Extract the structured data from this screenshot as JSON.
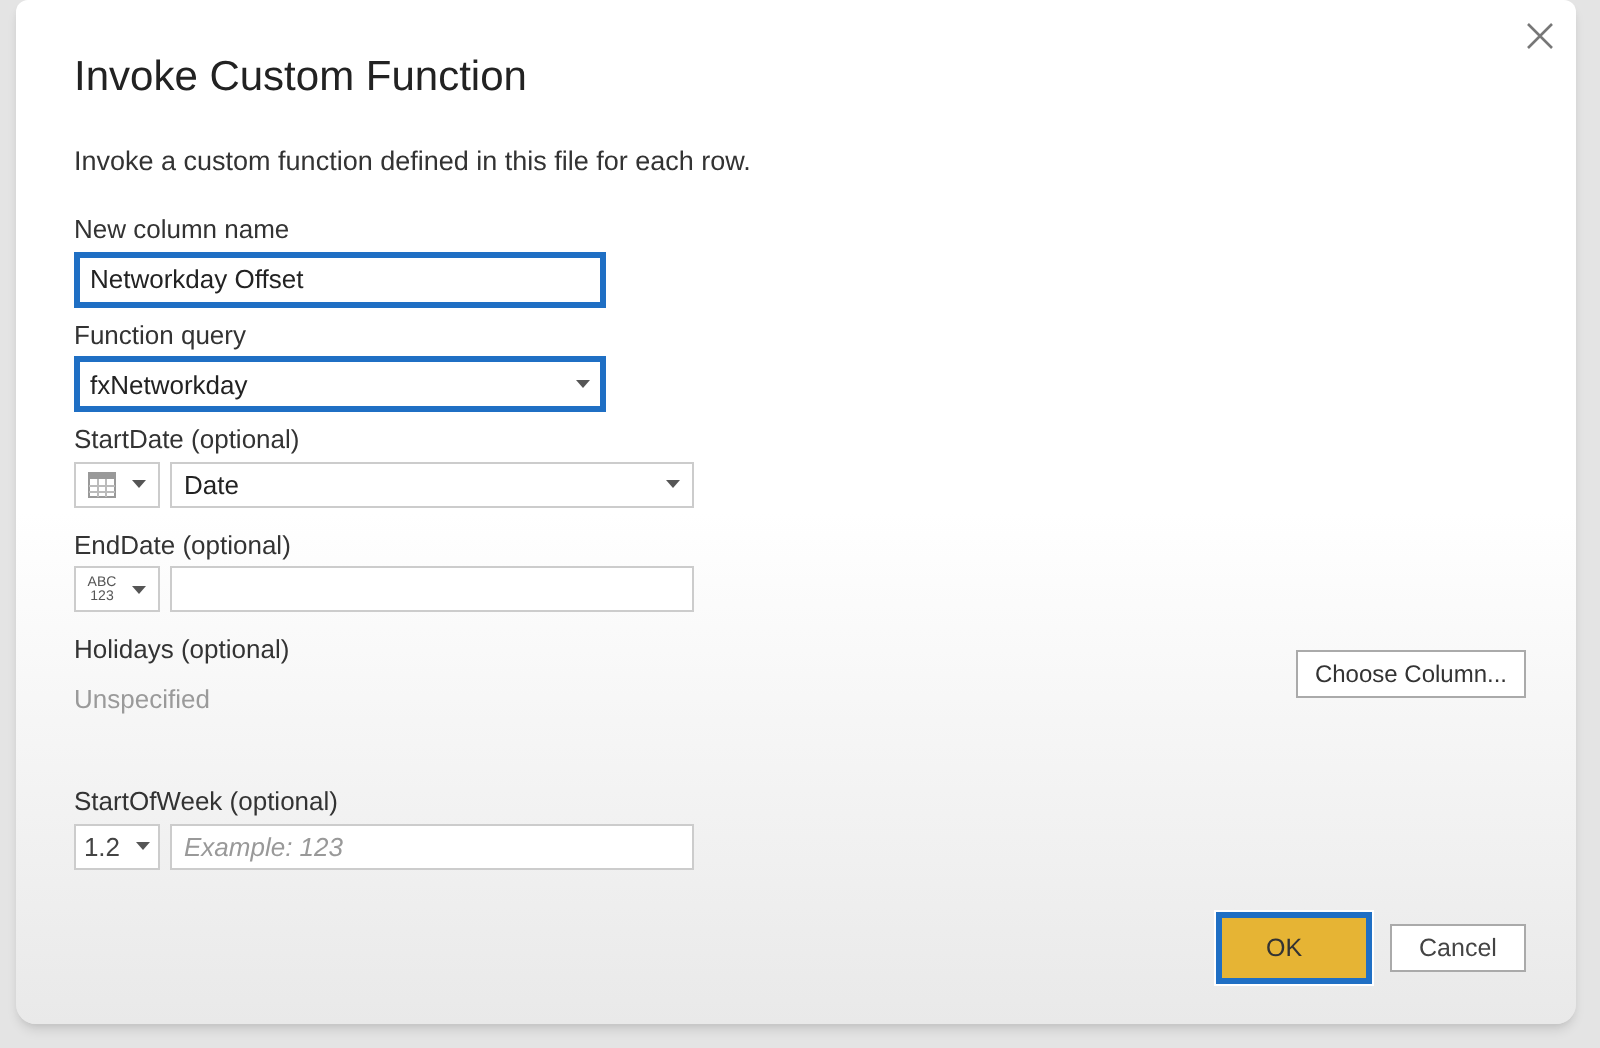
{
  "dialog": {
    "title": "Invoke Custom Function",
    "description": "Invoke a custom function defined in this file for each row."
  },
  "fields": [
    {
      "kind": "text",
      "label": "New column name",
      "value": "Networkday Offset",
      "highlighted": true
    },
    {
      "kind": "select",
      "label": "Function query",
      "value": "fxNetworkday",
      "highlighted": true
    },
    {
      "kind": "typed",
      "label": "StartDate (optional)",
      "type_button": {
        "kind": "column"
      },
      "input": {
        "kind": "select",
        "value": "Date"
      }
    },
    {
      "kind": "typed",
      "label": "EndDate (optional)",
      "type_button": {
        "kind": "any",
        "text": [
          "ABC",
          "123"
        ]
      },
      "input": {
        "kind": "text"
      }
    },
    {
      "kind": "column",
      "label": "Holidays (optional)",
      "value": "Unspecified",
      "button": "Choose Column..."
    },
    {
      "kind": "typed",
      "label": "StartOfWeek (optional)",
      "type_button": {
        "kind": "decimal",
        "text": [
          "1.2"
        ]
      },
      "input": {
        "kind": "text",
        "placeholder": "Example: 123"
      }
    }
  ],
  "buttons": [
    {
      "label": "OK",
      "primary": true,
      "focused": true
    },
    {
      "label": "Cancel",
      "primary": false,
      "focused": false
    }
  ]
}
